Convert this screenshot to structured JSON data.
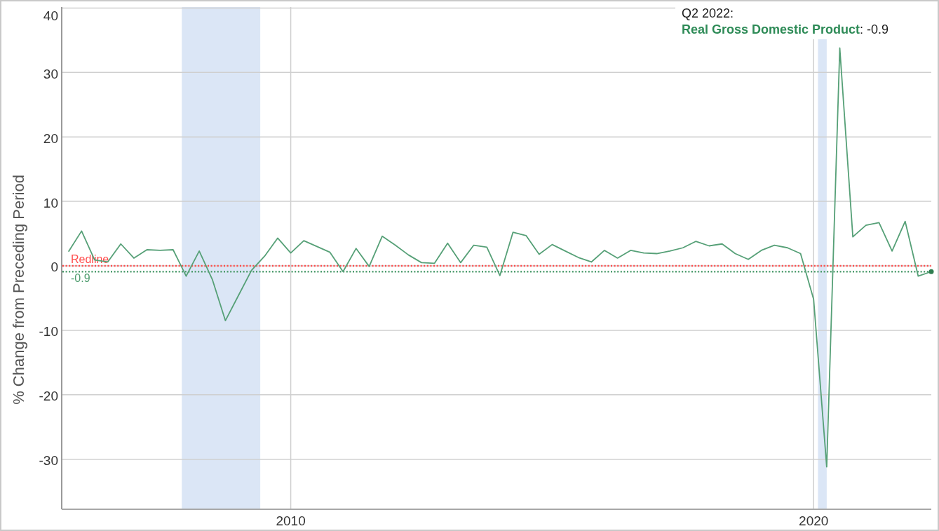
{
  "chart_data": {
    "type": "line",
    "ylabel": "% Change from Preceding Period",
    "x": [
      2005.75,
      2006,
      2006.25,
      2006.5,
      2006.75,
      2007,
      2007.25,
      2007.5,
      2007.75,
      2008,
      2008.25,
      2008.5,
      2008.75,
      2009,
      2009.25,
      2009.5,
      2009.75,
      2010,
      2010.25,
      2010.5,
      2010.75,
      2011,
      2011.25,
      2011.5,
      2011.75,
      2012,
      2012.25,
      2012.5,
      2012.75,
      2013,
      2013.25,
      2013.5,
      2013.75,
      2014,
      2014.25,
      2014.5,
      2014.75,
      2015,
      2015.25,
      2015.5,
      2015.75,
      2016,
      2016.25,
      2016.5,
      2016.75,
      2017,
      2017.25,
      2017.5,
      2017.75,
      2018,
      2018.25,
      2018.5,
      2018.75,
      2019,
      2019.25,
      2019.5,
      2019.75,
      2020,
      2020.25,
      2020.5,
      2020.75,
      2021,
      2021.25,
      2021.5,
      2021.75,
      2022,
      2022.25
    ],
    "values": [
      2.2,
      5.4,
      0.9,
      0.6,
      3.4,
      1.2,
      2.5,
      2.4,
      2.5,
      -1.6,
      2.3,
      -2.1,
      -8.5,
      -4.6,
      -0.7,
      1.5,
      4.3,
      2.0,
      3.9,
      3.0,
      2.1,
      -0.9,
      2.7,
      -0.1,
      4.6,
      3.2,
      1.7,
      0.5,
      0.4,
      3.5,
      0.5,
      3.2,
      2.9,
      -1.5,
      5.2,
      4.7,
      1.8,
      3.3,
      2.3,
      1.3,
      0.6,
      2.4,
      1.2,
      2.4,
      2.0,
      1.9,
      2.3,
      2.8,
      3.8,
      3.1,
      3.4,
      1.9,
      1.0,
      2.4,
      3.2,
      2.8,
      1.9,
      -5.2,
      -31.2,
      33.8,
      4.5,
      6.3,
      6.7,
      2.3,
      6.9,
      -1.6,
      -0.9
    ],
    "xlim": [
      2005.62,
      2022.25
    ],
    "ylim": [
      -37.76,
      40.15
    ],
    "xticks": [
      2010,
      2020
    ],
    "yticks": [
      -30,
      -20,
      -10,
      0,
      10,
      20,
      30,
      40
    ],
    "grid": true,
    "bands": [
      {
        "axis": "x",
        "from": 2007.917,
        "to": 2009.417
      },
      {
        "axis": "x",
        "from": 2020.083,
        "to": 2020.25
      }
    ],
    "ref_lines": [
      {
        "axis": "y",
        "value": 0,
        "label": "Redline",
        "color": "#ff4d4d"
      },
      {
        "axis": "y",
        "value": -0.9,
        "label": "-0.9",
        "color": "#4f9d6f"
      }
    ]
  },
  "tooltip": {
    "title": "Q2 2022:",
    "text": "**Real Gross Domestic Product**: -0.9"
  }
}
